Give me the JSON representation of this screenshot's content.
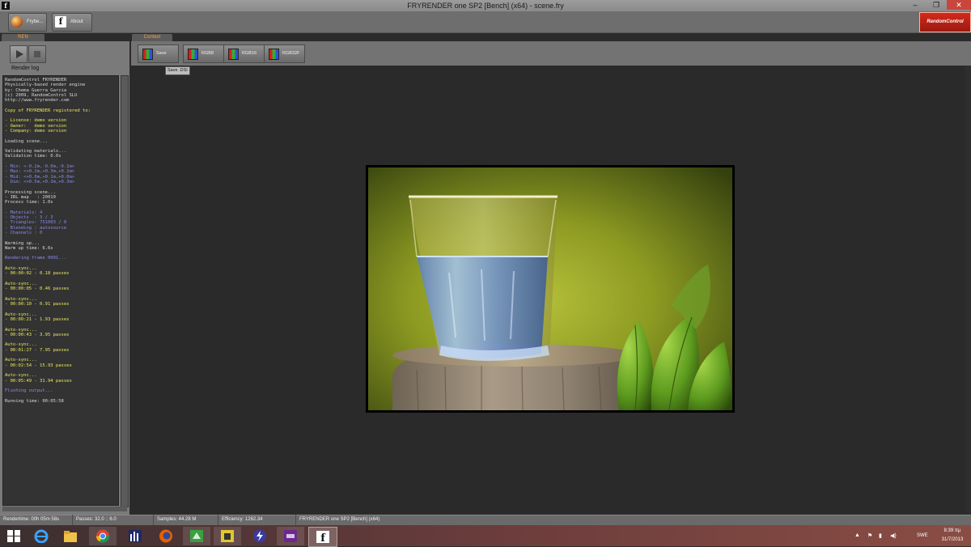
{
  "window": {
    "title": "FRYRENDER one SP2 [Bench] (x64) - scene.fry",
    "app_icon_glyph": "f",
    "min_glyph": "–",
    "max_glyph": "❐",
    "close_glyph": "✕"
  },
  "toolbar": {
    "frybe_label": "Frybe...",
    "about_label": "About",
    "about_glyph": "f",
    "logo_text": "RandomControl"
  },
  "left_panel": {
    "tab_label": "REN",
    "render_log_label": "Render log",
    "log_lines": [
      {
        "t": "RandomControl FRYRENDER",
        "c": "w"
      },
      {
        "t": "Physically-based render engine",
        "c": "w"
      },
      {
        "t": "by: Chema Guerra Garcia",
        "c": "w"
      },
      {
        "t": "(c) 2009, RandomControl SLU",
        "c": "w"
      },
      {
        "t": "http://www.fryrender.com",
        "c": "w"
      },
      {
        "t": "",
        "c": "w"
      },
      {
        "t": "Copy of FRYRENDER registered to:",
        "c": "y"
      },
      {
        "t": "",
        "c": "w"
      },
      {
        "t": "- License: demo version",
        "c": "y"
      },
      {
        "t": "- Owner:   demo version",
        "c": "y"
      },
      {
        "t": "- Company: demo version",
        "c": "y"
      },
      {
        "t": "",
        "c": "w"
      },
      {
        "t": "Loading scene...",
        "c": "w"
      },
      {
        "t": "",
        "c": "w"
      },
      {
        "t": "Validating materials...",
        "c": "w"
      },
      {
        "t": "Validation time: 0.0s",
        "c": "w"
      },
      {
        "t": "",
        "c": "w"
      },
      {
        "t": "- Min: <-0.2m,-0.0m,-0.1m>",
        "c": "b"
      },
      {
        "t": "- Max: <+0.2m,+0.3m,+0.1m>",
        "c": "b"
      },
      {
        "t": "- Mid: <+0.0m,+0.1m,+0.0m>",
        "c": "b"
      },
      {
        "t": "- Dim: <+0.5m,+0.3m,+0.3m>",
        "c": "b"
      },
      {
        "t": "",
        "c": "w"
      },
      {
        "t": "Processing scene...",
        "c": "w"
      },
      {
        "t": "- IBL map   : 20010",
        "c": "w"
      },
      {
        "t": "Process time: 1.0s",
        "c": "w"
      },
      {
        "t": "",
        "c": "w"
      },
      {
        "t": "- Materials: 4",
        "c": "b"
      },
      {
        "t": "- Objects  : 3 / 3",
        "c": "b"
      },
      {
        "t": "- Triangles: 751003 / 0",
        "c": "b"
      },
      {
        "t": "- Blending : autosource",
        "c": "b"
      },
      {
        "t": "- Channels : 0",
        "c": "b"
      },
      {
        "t": "",
        "c": "w"
      },
      {
        "t": "Warming up...",
        "c": "w"
      },
      {
        "t": "Warm up time: 6.6s",
        "c": "w"
      },
      {
        "t": "",
        "c": "w"
      },
      {
        "t": "Rendering frame 0001...",
        "c": "b"
      },
      {
        "t": "",
        "c": "w"
      },
      {
        "t": "Auto-sync...",
        "c": "y"
      },
      {
        "t": "- 00:00:02 - 0.18 passes",
        "c": "y"
      },
      {
        "t": "",
        "c": "w"
      },
      {
        "t": "Auto-sync...",
        "c": "y"
      },
      {
        "t": "- 00:00:05 - 0.46 passes",
        "c": "y"
      },
      {
        "t": "",
        "c": "w"
      },
      {
        "t": "Auto-sync...",
        "c": "y"
      },
      {
        "t": "- 00:00:10 - 0.91 passes",
        "c": "y"
      },
      {
        "t": "",
        "c": "w"
      },
      {
        "t": "Auto-sync...",
        "c": "y"
      },
      {
        "t": "- 00:00:21 - 1.93 passes",
        "c": "y"
      },
      {
        "t": "",
        "c": "w"
      },
      {
        "t": "Auto-sync...",
        "c": "y"
      },
      {
        "t": "- 00:00:43 - 3.95 passes",
        "c": "y"
      },
      {
        "t": "",
        "c": "w"
      },
      {
        "t": "Auto-sync...",
        "c": "y"
      },
      {
        "t": "- 00:01:27 - 7.95 passes",
        "c": "y"
      },
      {
        "t": "",
        "c": "w"
      },
      {
        "t": "Auto-sync...",
        "c": "y"
      },
      {
        "t": "- 00:02:54 - 15.93 passes",
        "c": "y"
      },
      {
        "t": "",
        "c": "w"
      },
      {
        "t": "Auto-sync...",
        "c": "y"
      },
      {
        "t": "- 00:05:49 - 31.94 passes",
        "c": "y"
      },
      {
        "t": "",
        "c": "w"
      },
      {
        "t": "Flushing output...",
        "c": "b"
      },
      {
        "t": "",
        "c": "w"
      },
      {
        "t": "Running time: 00:05:58",
        "c": "w"
      }
    ]
  },
  "context": {
    "tab_label": "Context",
    "save_label": "Save",
    "rgb8_label": "RGB8",
    "rgb16_label": "RGB16",
    "rgb32f_label": "RGB32F",
    "tooltip": "Save .DSI"
  },
  "status": {
    "rendertime": "Rendertime: 00h 05m 58s",
    "passes": "Passes: 32.0 :: 6.0",
    "samples": "Samples: 44.28 M",
    "efficiency": "Efficiency: 1262.34",
    "version": "FRYRENDER one SP2 [Bench] (x64)"
  },
  "taskbar": {
    "apps": [
      "windows-start-icon",
      "internet-explorer-icon",
      "file-explorer-icon",
      "chrome-icon",
      "app-bars-icon",
      "firefox-icon",
      "app-green-icon",
      "app-cup-icon",
      "app-lightning-icon",
      "app-purple-icon",
      "fryrender-icon"
    ],
    "tray_arrow": "▲",
    "tray_flag": "⚑",
    "tray_sound": "◀)",
    "tray_net": "▮",
    "lang": "SWE",
    "time": "8:39 πμ",
    "date": "31/7/2013"
  }
}
